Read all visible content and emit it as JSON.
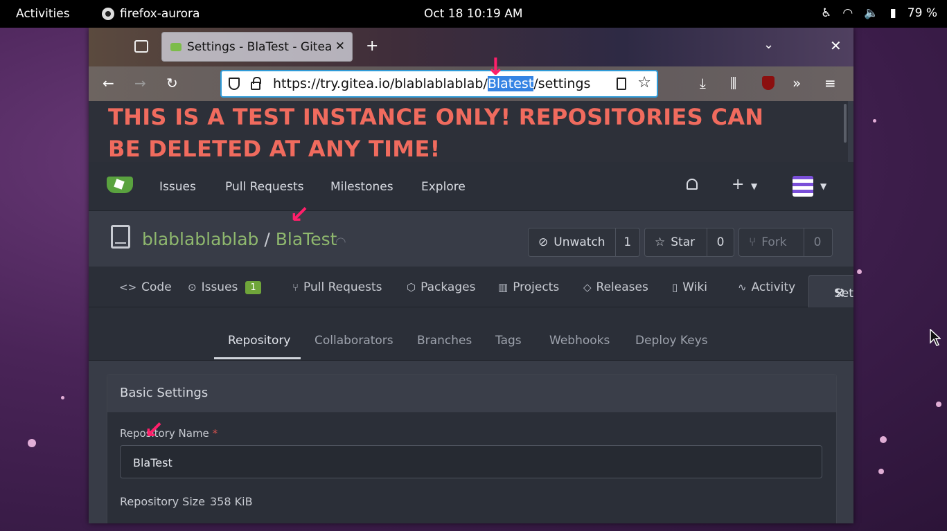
{
  "system_bar": {
    "activities": "Activities",
    "app_name": "firefox-aurora",
    "clock": "Oct 18  10:19 AM",
    "battery": "79 %"
  },
  "browser": {
    "tab_title": "Settings - BlaTest - Gitea:",
    "url_prefix": "https://try.gitea.io/blablablablab/",
    "url_selected": "Blatest",
    "url_suffix": "/settings"
  },
  "page": {
    "banner": "THIS IS A TEST INSTANCE ONLY! REPOSITORIES CAN BE DELETED AT ANY TIME!",
    "nav": {
      "issues": "Issues",
      "pull_requests": "Pull Requests",
      "milestones": "Milestones",
      "explore": "Explore"
    },
    "repo": {
      "owner": "blablablablab",
      "separator": "/",
      "name": "BlaTest",
      "unwatch": "Unwatch",
      "watch_count": "1",
      "star": "Star",
      "star_count": "0",
      "fork": "Fork",
      "fork_count": "0"
    },
    "repo_tabs": {
      "code": "Code",
      "issues": "Issues",
      "issues_count": "1",
      "pull_requests": "Pull Requests",
      "packages": "Packages",
      "projects": "Projects",
      "releases": "Releases",
      "wiki": "Wiki",
      "activity": "Activity",
      "settings": "Settings"
    },
    "settings_tabs": {
      "repository": "Repository",
      "collaborators": "Collaborators",
      "branches": "Branches",
      "tags": "Tags",
      "webhooks": "Webhooks",
      "deploy_keys": "Deploy Keys"
    },
    "basic_settings": {
      "heading": "Basic Settings",
      "repo_name_label": "Repository Name",
      "required_mark": "*",
      "repo_name_value": "BlaTest",
      "repo_size_label": "Repository Size",
      "repo_size_value": "358 KiB"
    }
  },
  "colors": {
    "banner_red": "#f06b5e",
    "repo_link_green": "#8fb86e",
    "annotation_arrow": "#ff1f6a",
    "url_selection": "#3584e4"
  }
}
